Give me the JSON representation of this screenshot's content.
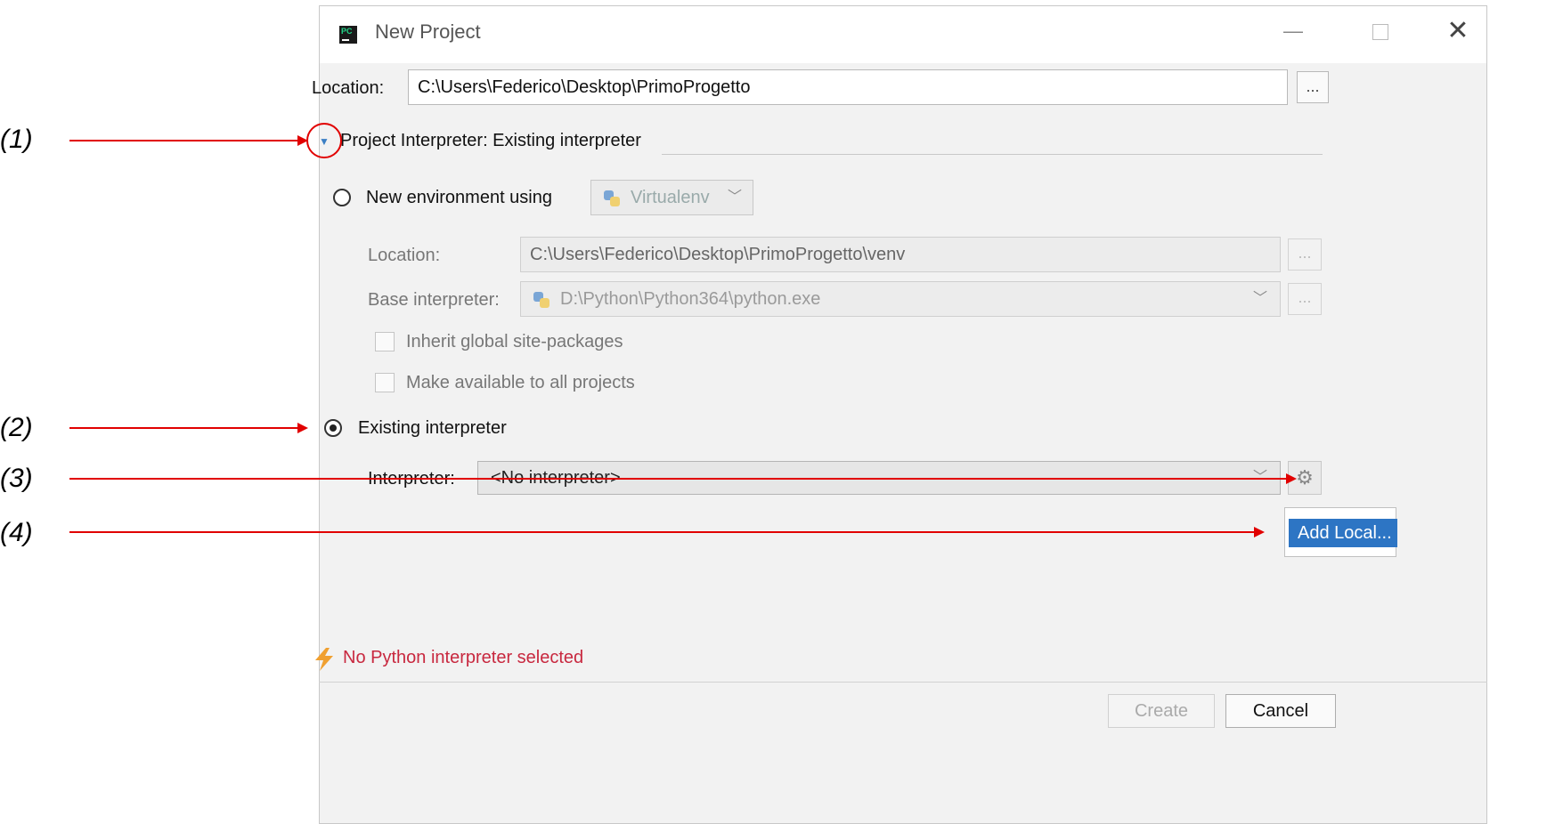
{
  "window": {
    "title": "New Project",
    "app_icon_text": "PC"
  },
  "location": {
    "label": "Location:",
    "value": "C:\\Users\\Federico\\Desktop\\PrimoProgetto",
    "browse_label": "..."
  },
  "interpreter_section": {
    "title": "Project Interpreter: Existing interpreter"
  },
  "new_env": {
    "radio_label": "New environment using",
    "tool_select": "Virtualenv",
    "location_label": "Location:",
    "location_value": "C:\\Users\\Federico\\Desktop\\PrimoProgetto\\venv",
    "browse_label": "...",
    "base_label": "Base interpreter:",
    "base_value": "D:\\Python\\Python364\\python.exe",
    "inherit_label": "Inherit global site-packages",
    "available_label": "Make available to all projects"
  },
  "existing": {
    "radio_label": "Existing interpreter",
    "interpreter_label": "Interpreter:",
    "interpreter_value": "<No interpreter>"
  },
  "popup": {
    "item": "Add Local..."
  },
  "status": {
    "error": "No Python interpreter selected"
  },
  "buttons": {
    "create": "Create",
    "cancel": "Cancel"
  },
  "annotations": {
    "a1": "(1)",
    "a2": "(2)",
    "a3": "(3)",
    "a4": "(4)"
  },
  "colors": {
    "accent": "#2d75c4",
    "error": "#c8283f",
    "annotation": "#e10000"
  }
}
